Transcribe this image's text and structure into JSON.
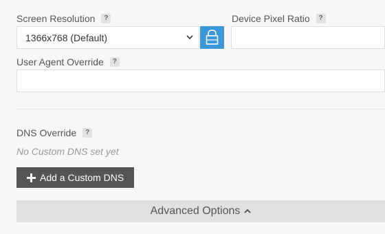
{
  "screen_resolution": {
    "label": "Screen Resolution",
    "help": "?",
    "selected": "1366x768 (Default)"
  },
  "device_pixel_ratio": {
    "label": "Device Pixel Ratio",
    "help": "?",
    "value": ""
  },
  "user_agent": {
    "label": "User Agent Override",
    "help": "?",
    "value": ""
  },
  "dns": {
    "label": "DNS Override",
    "help": "?",
    "empty_text": "No Custom DNS set yet",
    "add_button": "Add a Custom DNS"
  },
  "advanced": {
    "label": "Advanced Options"
  },
  "icons": {
    "lock": "lock-icon",
    "chevron": "chevron-down-icon",
    "plus": "plus-icon",
    "caret": "chevron-up-icon"
  },
  "colors": {
    "lock_button": "#3a98d8",
    "add_button": "#555555",
    "advanced_bar": "#e1e1e1"
  }
}
